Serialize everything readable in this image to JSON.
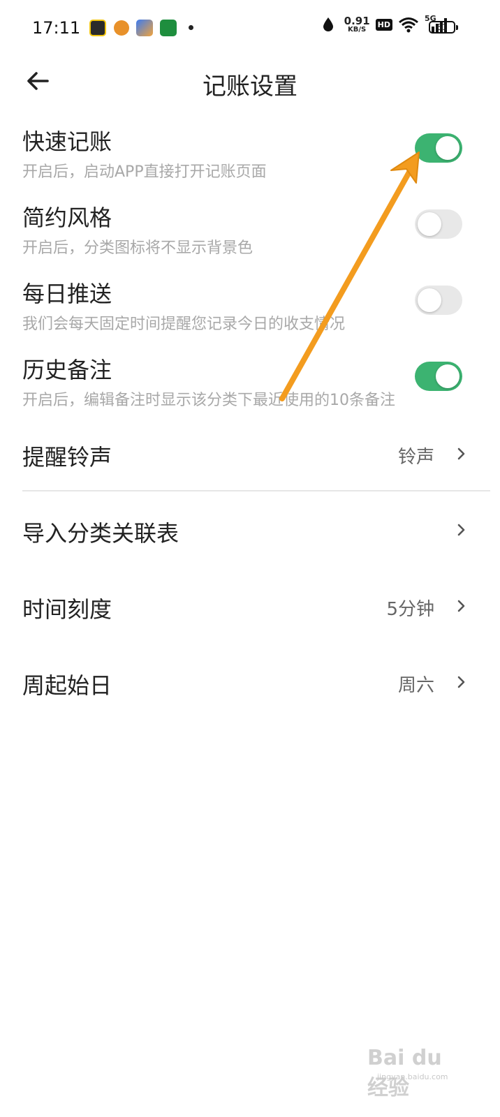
{
  "status_bar": {
    "time": "17:11",
    "app_icons": [
      "game-app-icon",
      "orange-app-icon",
      "blue-app-icon",
      "green-app-icon"
    ],
    "net_speed": "0.91",
    "net_unit": "KB/S",
    "hd": "HD",
    "signal": "5G",
    "battery": "61"
  },
  "header": {
    "title": "记账设置"
  },
  "settings": {
    "toggles": [
      {
        "title": "快速记账",
        "subtitle": "开启后，启动APP直接打开记账页面",
        "on": true
      },
      {
        "title": "简约风格",
        "subtitle": "开启后，分类图标将不显示背景色",
        "on": false
      },
      {
        "title": "每日推送",
        "subtitle": "我们会每天固定时间提醒您记录今日的收支情况",
        "on": false
      },
      {
        "title": "历史备注",
        "subtitle": "开启后，编辑备注时显示该分类下最近使用的10条备注",
        "on": true
      }
    ],
    "nav": [
      {
        "title": "提醒铃声",
        "value": "铃声"
      },
      {
        "title": "导入分类关联表",
        "value": ""
      },
      {
        "title": "时间刻度",
        "value": "5分钟"
      },
      {
        "title": "周起始日",
        "value": "周六"
      }
    ]
  },
  "colors": {
    "toggle_on": "#3cb371",
    "toggle_off": "#e8e8e8",
    "annotation_arrow": "#f39c1f"
  },
  "watermark": {
    "text": "Bai du 经验",
    "sub": "jingyan.baidu.com"
  }
}
